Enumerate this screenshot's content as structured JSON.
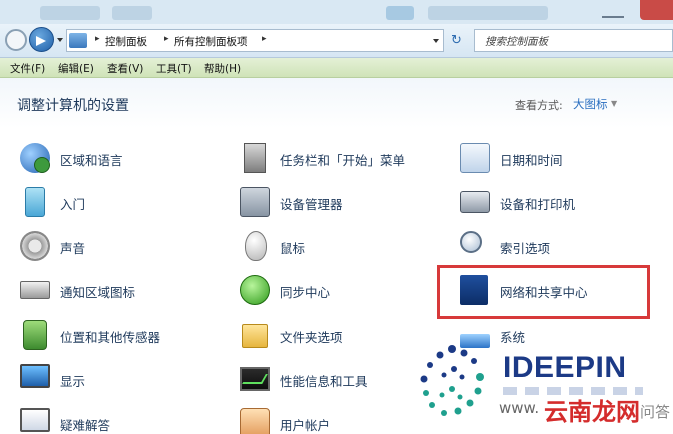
{
  "address_bar": {
    "crumbs": [
      "控制面板",
      "所有控制面板项"
    ],
    "search_placeholder": "搜索控制面板"
  },
  "menu": [
    "文件(F)",
    "编辑(E)",
    "查看(V)",
    "工具(T)",
    "帮助(H)"
  ],
  "header": {
    "title": "调整计算机的设置",
    "view_by_label": "查看方式:",
    "view_by_value": "大图标"
  },
  "items": {
    "col1": [
      "区域和语言",
      "入门",
      "声音",
      "通知区域图标",
      "位置和其他传感器",
      "显示",
      "疑难解答"
    ],
    "col2": [
      "任务栏和「开始」菜单",
      "设备管理器",
      "鼠标",
      "同步中心",
      "文件夹选项",
      "性能信息和工具",
      "用户帐户"
    ],
    "col3": [
      "日期和时间",
      "设备和打印机",
      "索引选项",
      "网络和共享中心",
      "系统"
    ]
  },
  "highlighted_item": "网络和共享中心",
  "watermark": {
    "brand": "IDEEPIN",
    "prefix": "www.",
    "site": "云南龙网",
    "suffix": "问答"
  },
  "colors": {
    "menubar": "#cfe3b8",
    "highlight": "#d7393a",
    "link": "#2a6fc0",
    "text": "#1e395b"
  },
  "icons": {
    "col1": [
      "globe-icon",
      "getting-started-icon",
      "speaker-icon",
      "tray-icon",
      "sensor-icon",
      "monitor-icon",
      "troubleshoot-icon"
    ],
    "col2": [
      "taskbar-icon",
      "device-manager-icon",
      "mouse-icon",
      "sync-icon",
      "folder-icon",
      "performance-icon",
      "user-icon"
    ],
    "col3": [
      "calendar-icon",
      "printer-icon",
      "magnifier-icon",
      "network-icon",
      "system-icon"
    ]
  }
}
